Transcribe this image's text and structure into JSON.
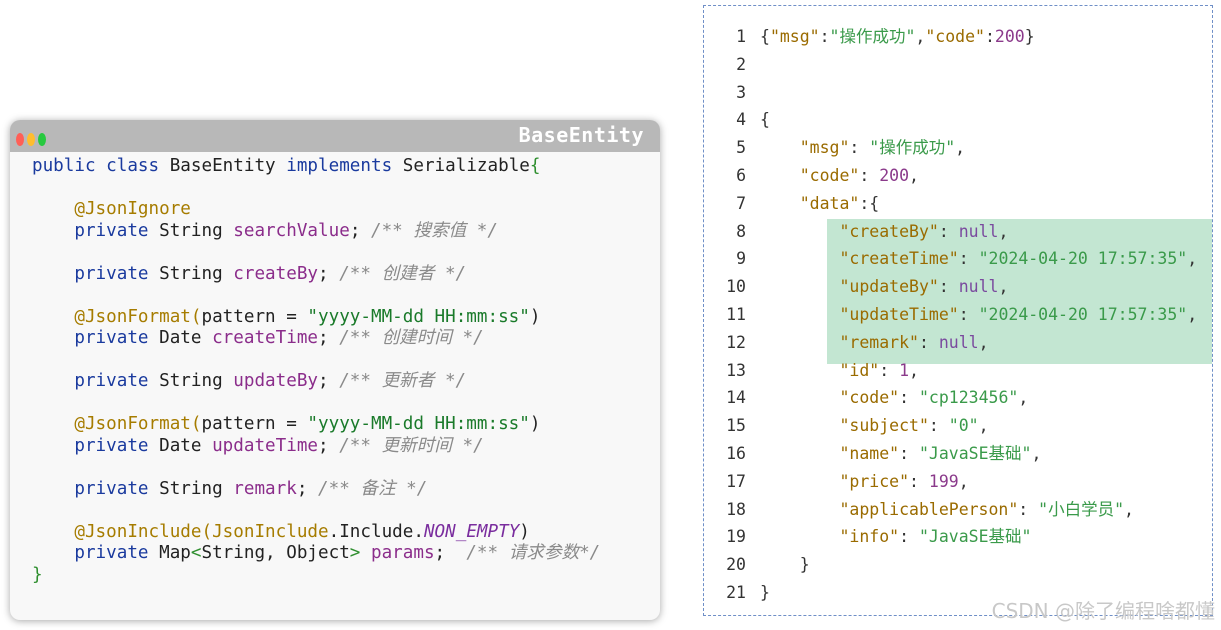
{
  "window": {
    "title": "BaseEntity"
  },
  "code": {
    "lines": [
      [
        [
          "kw",
          "public class "
        ],
        [
          "plain",
          "BaseEntity "
        ],
        [
          "kw",
          "implements "
        ],
        [
          "plain",
          "Serializable"
        ],
        [
          "brace",
          "{"
        ]
      ],
      [],
      [
        [
          "plain",
          "    "
        ],
        [
          "ann",
          "@JsonIgnore"
        ]
      ],
      [
        [
          "plain",
          "    "
        ],
        [
          "kw",
          "private "
        ],
        [
          "plain",
          "String "
        ],
        [
          "field",
          "searchValue"
        ],
        [
          "plain",
          "; "
        ],
        [
          "cmt",
          "/** 搜索值 */"
        ]
      ],
      [],
      [
        [
          "plain",
          "    "
        ],
        [
          "kw",
          "private "
        ],
        [
          "plain",
          "String "
        ],
        [
          "field",
          "createBy"
        ],
        [
          "plain",
          "; "
        ],
        [
          "cmt",
          "/** 创建者 */"
        ]
      ],
      [],
      [
        [
          "plain",
          "    "
        ],
        [
          "ann",
          "@JsonFormat("
        ],
        [
          "plain",
          "pattern = "
        ],
        [
          "str",
          "\"yyyy-MM-dd HH:mm:ss\""
        ],
        [
          "plain",
          ")"
        ]
      ],
      [
        [
          "plain",
          "    "
        ],
        [
          "kw",
          "private "
        ],
        [
          "plain",
          "Date "
        ],
        [
          "field",
          "createTime"
        ],
        [
          "plain",
          "; "
        ],
        [
          "cmt",
          "/** 创建时间 */"
        ]
      ],
      [],
      [
        [
          "plain",
          "    "
        ],
        [
          "kw",
          "private "
        ],
        [
          "plain",
          "String "
        ],
        [
          "field",
          "updateBy"
        ],
        [
          "plain",
          "; "
        ],
        [
          "cmt",
          "/** 更新者 */"
        ]
      ],
      [],
      [
        [
          "plain",
          "    "
        ],
        [
          "ann",
          "@JsonFormat("
        ],
        [
          "plain",
          "pattern = "
        ],
        [
          "str",
          "\"yyyy-MM-dd HH:mm:ss\""
        ],
        [
          "plain",
          ")"
        ]
      ],
      [
        [
          "plain",
          "    "
        ],
        [
          "kw",
          "private "
        ],
        [
          "plain",
          "Date "
        ],
        [
          "field",
          "updateTime"
        ],
        [
          "plain",
          "; "
        ],
        [
          "cmt",
          "/** 更新时间 */"
        ]
      ],
      [],
      [
        [
          "plain",
          "    "
        ],
        [
          "kw",
          "private "
        ],
        [
          "plain",
          "String "
        ],
        [
          "field",
          "remark"
        ],
        [
          "plain",
          "; "
        ],
        [
          "cmt",
          "/** 备注 */"
        ]
      ],
      [],
      [
        [
          "plain",
          "    "
        ],
        [
          "ann",
          "@JsonInclude("
        ],
        [
          "ann",
          "JsonInclude"
        ],
        [
          "plain",
          ".Include."
        ],
        [
          "const",
          "NON_EMPTY"
        ],
        [
          "plain",
          ")"
        ]
      ],
      [
        [
          "plain",
          "    "
        ],
        [
          "kw",
          "private "
        ],
        [
          "plain",
          "Map"
        ],
        [
          "brace",
          "<"
        ],
        [
          "plain",
          "String, Object"
        ],
        [
          "brace",
          ">"
        ],
        [
          "plain",
          " "
        ],
        [
          "field",
          "params"
        ],
        [
          "plain",
          ";  "
        ],
        [
          "cmt",
          "/** 请求参数*/"
        ]
      ],
      [
        [
          "brace",
          "}"
        ]
      ]
    ]
  },
  "json": {
    "lines": [
      {
        "num": "1",
        "tokens": [
          [
            "jpunc",
            "{"
          ],
          [
            "jkey",
            "\"msg\""
          ],
          [
            "jpunc",
            ":"
          ],
          [
            "jstr",
            "\"操作成功\""
          ],
          [
            "jpunc",
            ","
          ],
          [
            "jkey",
            "\"code\""
          ],
          [
            "jpunc",
            ":"
          ],
          [
            "jnum",
            "200"
          ],
          [
            "jpunc",
            "}"
          ]
        ]
      },
      {
        "num": "2",
        "tokens": []
      },
      {
        "num": "3",
        "tokens": []
      },
      {
        "num": "4",
        "tokens": [
          [
            "jpunc",
            "{"
          ]
        ]
      },
      {
        "num": "5",
        "tokens": [
          [
            "jpunc",
            "    "
          ],
          [
            "jkey",
            "\"msg\""
          ],
          [
            "jpunc",
            ": "
          ],
          [
            "jstr",
            "\"操作成功\""
          ],
          [
            "jpunc",
            ","
          ]
        ]
      },
      {
        "num": "6",
        "tokens": [
          [
            "jpunc",
            "    "
          ],
          [
            "jkey",
            "\"code\""
          ],
          [
            "jpunc",
            ": "
          ],
          [
            "jnum",
            "200"
          ],
          [
            "jpunc",
            ","
          ]
        ]
      },
      {
        "num": "7",
        "tokens": [
          [
            "jpunc",
            "    "
          ],
          [
            "jkey",
            "\"data\""
          ],
          [
            "jpunc",
            ":{"
          ]
        ]
      },
      {
        "num": "8",
        "tokens": [
          [
            "jpunc",
            "        "
          ],
          [
            "jkey",
            "\"createBy\""
          ],
          [
            "jpunc",
            ": "
          ],
          [
            "jnull",
            "null"
          ],
          [
            "jpunc",
            ","
          ]
        ]
      },
      {
        "num": "9",
        "tokens": [
          [
            "jpunc",
            "        "
          ],
          [
            "jkey",
            "\"createTime\""
          ],
          [
            "jpunc",
            ": "
          ],
          [
            "jstr",
            "\"2024-04-20 17:57:35\""
          ],
          [
            "jpunc",
            ","
          ]
        ]
      },
      {
        "num": "10",
        "tokens": [
          [
            "jpunc",
            "        "
          ],
          [
            "jkey",
            "\"updateBy\""
          ],
          [
            "jpunc",
            ": "
          ],
          [
            "jnull",
            "null"
          ],
          [
            "jpunc",
            ","
          ]
        ]
      },
      {
        "num": "11",
        "tokens": [
          [
            "jpunc",
            "        "
          ],
          [
            "jkey",
            "\"updateTime\""
          ],
          [
            "jpunc",
            ": "
          ],
          [
            "jstr",
            "\"2024-04-20 17:57:35\""
          ],
          [
            "jpunc",
            ","
          ]
        ]
      },
      {
        "num": "12",
        "tokens": [
          [
            "jpunc",
            "        "
          ],
          [
            "jkey",
            "\"remark\""
          ],
          [
            "jpunc",
            ": "
          ],
          [
            "jnull",
            "null"
          ],
          [
            "jpunc",
            ","
          ]
        ]
      },
      {
        "num": "13",
        "tokens": [
          [
            "jpunc",
            "        "
          ],
          [
            "jkey",
            "\"id\""
          ],
          [
            "jpunc",
            ": "
          ],
          [
            "jnum",
            "1"
          ],
          [
            "jpunc",
            ","
          ]
        ]
      },
      {
        "num": "14",
        "tokens": [
          [
            "jpunc",
            "        "
          ],
          [
            "jkey",
            "\"code\""
          ],
          [
            "jpunc",
            ": "
          ],
          [
            "jstr",
            "\"cp123456\""
          ],
          [
            "jpunc",
            ","
          ]
        ]
      },
      {
        "num": "15",
        "tokens": [
          [
            "jpunc",
            "        "
          ],
          [
            "jkey",
            "\"subject\""
          ],
          [
            "jpunc",
            ": "
          ],
          [
            "jstr",
            "\"0\""
          ],
          [
            "jpunc",
            ","
          ]
        ]
      },
      {
        "num": "16",
        "tokens": [
          [
            "jpunc",
            "        "
          ],
          [
            "jkey",
            "\"name\""
          ],
          [
            "jpunc",
            ": "
          ],
          [
            "jstr",
            "\"JavaSE基础\""
          ],
          [
            "jpunc",
            ","
          ]
        ]
      },
      {
        "num": "17",
        "tokens": [
          [
            "jpunc",
            "        "
          ],
          [
            "jkey",
            "\"price\""
          ],
          [
            "jpunc",
            ": "
          ],
          [
            "jnum",
            "199"
          ],
          [
            "jpunc",
            ","
          ]
        ]
      },
      {
        "num": "18",
        "tokens": [
          [
            "jpunc",
            "        "
          ],
          [
            "jkey",
            "\"applicablePerson\""
          ],
          [
            "jpunc",
            ": "
          ],
          [
            "jstr",
            "\"小白学员\""
          ],
          [
            "jpunc",
            ","
          ]
        ]
      },
      {
        "num": "19",
        "tokens": [
          [
            "jpunc",
            "        "
          ],
          [
            "jkey",
            "\"info\""
          ],
          [
            "jpunc",
            ": "
          ],
          [
            "jstr",
            "\"JavaSE基础\""
          ]
        ]
      },
      {
        "num": "20",
        "tokens": [
          [
            "jpunc",
            "    }"
          ]
        ]
      },
      {
        "num": "21",
        "tokens": [
          [
            "jpunc",
            "}"
          ]
        ]
      }
    ]
  },
  "watermark": "CSDN @除了编程啥都懂"
}
